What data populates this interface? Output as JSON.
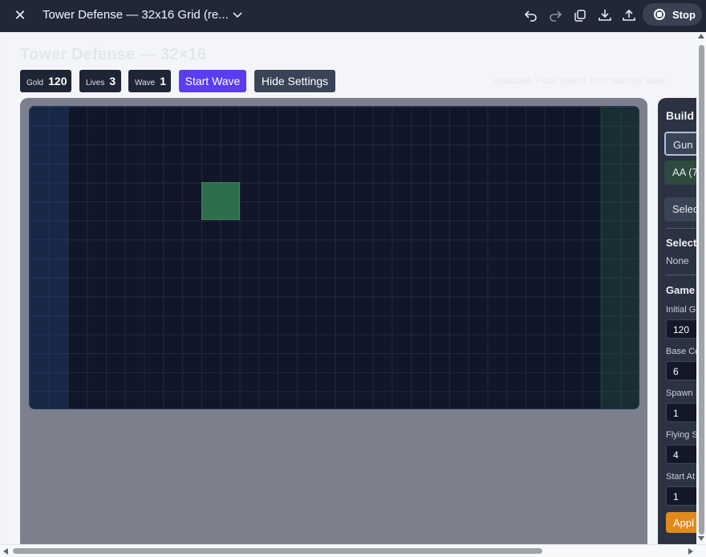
{
  "window": {
    "title": "Tower Defense — 32x16 Grid (re...",
    "stop_label": "Stop",
    "icons": [
      "close-icon",
      "chevron-down-icon",
      "undo-icon",
      "redo-icon",
      "copy-icon",
      "download-icon",
      "share-icon",
      "stop-icon"
    ]
  },
  "game": {
    "title": "Tower Defense — 32×16",
    "stats": [
      {
        "label": "Gold",
        "value": "120"
      },
      {
        "label": "Lives",
        "value": "3"
      },
      {
        "label": "Wave",
        "value": "1"
      }
    ],
    "start_wave_label": "Start Wave",
    "hide_settings_label": "Hide Settings",
    "status": "Initialized. Place towers, then start the wave!",
    "grid": {
      "cols": 32,
      "rows": 16
    }
  },
  "panel": {
    "build_heading": "Build",
    "gun_label": "Gun (",
    "aa_label": "AA (7",
    "select_label": "Selec",
    "selected_heading": "Selecte",
    "selected_value": "None",
    "game_heading": "Game",
    "fields": [
      {
        "label": "Initial G",
        "value": "120"
      },
      {
        "label": "Base Co",
        "value": "6"
      },
      {
        "label": "Spawn",
        "value": "1"
      },
      {
        "label": "Flying S",
        "value": "4"
      },
      {
        "label": "Start At",
        "value": "1"
      }
    ],
    "apply_label": "Appl"
  }
}
